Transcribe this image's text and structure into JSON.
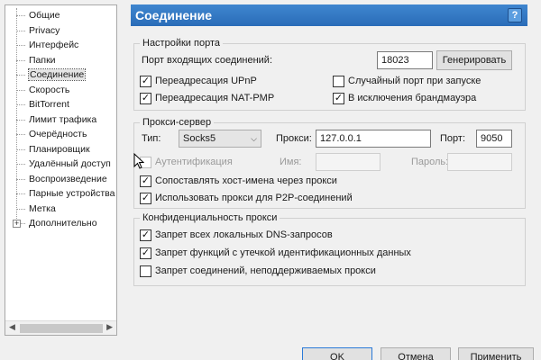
{
  "tree": {
    "items": [
      {
        "label": "Общие"
      },
      {
        "label": "Privacy"
      },
      {
        "label": "Интерфейс"
      },
      {
        "label": "Папки"
      },
      {
        "label": "Соединение",
        "selected": true
      },
      {
        "label": "Скорость"
      },
      {
        "label": "BitTorrent"
      },
      {
        "label": "Лимит трафика"
      },
      {
        "label": "Очерёдность"
      },
      {
        "label": "Планировщик"
      },
      {
        "label": "Удалённый доступ"
      },
      {
        "label": "Воспроизведение"
      },
      {
        "label": "Парные устройства"
      },
      {
        "label": "Метка"
      },
      {
        "label": "Дополнительно",
        "expandable": true,
        "expander": "+"
      }
    ]
  },
  "header": {
    "title": "Соединение",
    "help": "?"
  },
  "port_settings": {
    "title": "Настройки порта",
    "port_label": "Порт входящих соединений:",
    "port_value": "18023",
    "generate_label": "Генерировать",
    "upnp_label": "Переадресация UPnP",
    "upnp_checked": true,
    "natpmp_label": "Переадресация NAT-PMP",
    "natpmp_checked": true,
    "random_port_label": "Случайный порт при запуске",
    "random_port_checked": false,
    "firewall_label": "В исключения брандмауэра",
    "firewall_checked": true
  },
  "proxy": {
    "title": "Прокси-сервер",
    "type_label": "Тип:",
    "type_value": "Socks5",
    "proxy_label": "Прокси:",
    "proxy_value": "127.0.0.1",
    "port_label": "Порт:",
    "port_value": "9050",
    "auth_label": "Аутентификация",
    "auth_checked": false,
    "name_label": "Имя:",
    "name_value": "",
    "password_label": "Пароль:",
    "password_value": "",
    "resolve_label": "Сопоставлять хост-имена через прокси",
    "resolve_checked": true,
    "p2p_label": "Использовать прокси для P2P-соединений",
    "p2p_checked": true
  },
  "privacy": {
    "title": "Конфиденциальность прокси",
    "dns_label": "Запрет всех локальных DNS-запросов",
    "dns_checked": true,
    "leak_label": "Запрет функций с утечкой идентификационных данных",
    "leak_checked": true,
    "unsupported_label": "Запрет соединений, неподдерживаемых прокси",
    "unsupported_checked": false
  },
  "footer": {
    "ok_label": "OK",
    "cancel_label": "Отмена",
    "apply_label": "Применить"
  },
  "icons": {
    "check_glyph": "✓",
    "caret": "⌵"
  }
}
